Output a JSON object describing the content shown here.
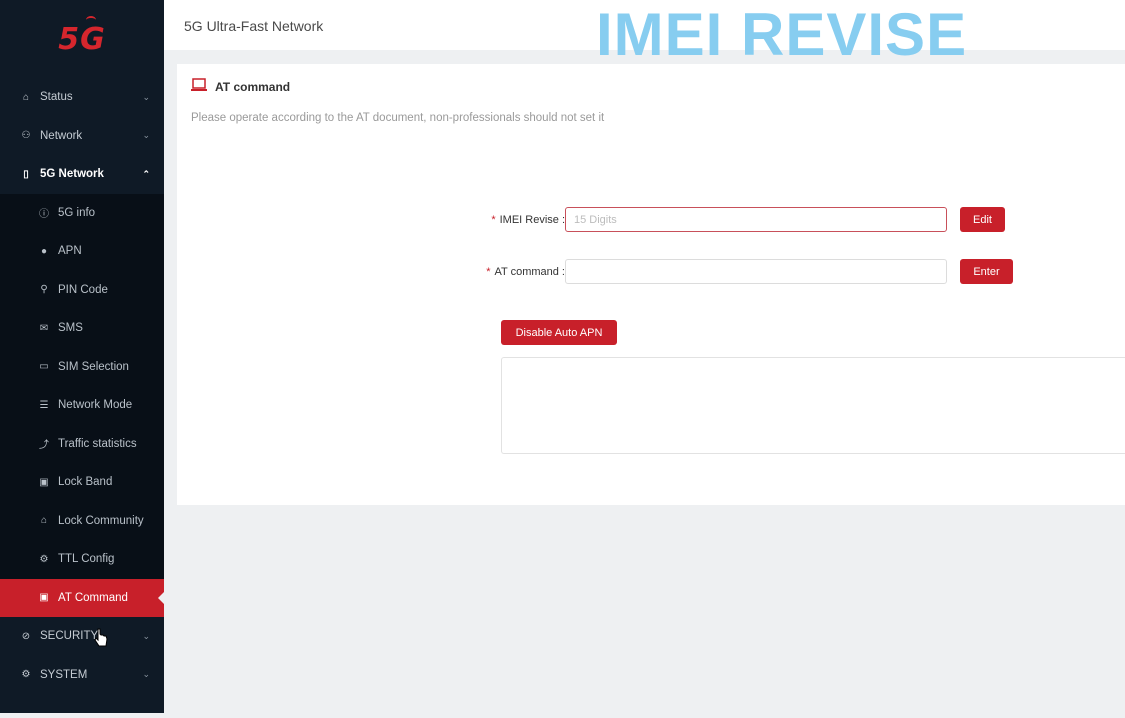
{
  "brand": {
    "logo_text": "5G"
  },
  "header": {
    "title": "5G Ultra-Fast Network"
  },
  "watermark": "IMEI REVISE",
  "sidebar": {
    "items": [
      {
        "label": "Status",
        "icon": "home-icon",
        "type": "top"
      },
      {
        "label": "Network",
        "icon": "network-icon",
        "type": "top"
      },
      {
        "label": "5G Network",
        "icon": "phone-icon",
        "type": "top",
        "open": true
      },
      {
        "label": "5G info",
        "icon": "info-icon",
        "type": "sub"
      },
      {
        "label": "APN",
        "icon": "globe-icon",
        "type": "sub"
      },
      {
        "label": "PIN Code",
        "icon": "key-icon",
        "type": "sub"
      },
      {
        "label": "SMS",
        "icon": "mail-icon",
        "type": "sub"
      },
      {
        "label": "SIM Selection",
        "icon": "card-icon",
        "type": "sub"
      },
      {
        "label": "Network Mode",
        "icon": "list-icon",
        "type": "sub"
      },
      {
        "label": "Traffic statistics",
        "icon": "trend-icon",
        "type": "sub"
      },
      {
        "label": "Lock Band",
        "icon": "grid-icon",
        "type": "sub"
      },
      {
        "label": "Lock Community",
        "icon": "home-icon",
        "type": "sub"
      },
      {
        "label": "TTL Config",
        "icon": "gear-icon",
        "type": "sub"
      },
      {
        "label": "AT Command",
        "icon": "laptop-icon",
        "type": "sub",
        "active": true
      },
      {
        "label": "SECURITY",
        "icon": "shield-icon",
        "type": "top"
      },
      {
        "label": "SYSTEM",
        "icon": "gear-icon",
        "type": "top"
      }
    ]
  },
  "card": {
    "title": "AT command",
    "description": "Please operate according to the AT document, non-professionals should not set it",
    "imei": {
      "label": "IMEI Revise :",
      "placeholder": "15 Digits",
      "value": "",
      "button": "Edit"
    },
    "at": {
      "label": "AT command :",
      "placeholder": "",
      "value": "",
      "button": "Enter"
    },
    "disable_auto_apn": "Disable Auto APN"
  },
  "colors": {
    "accent": "#c8202a",
    "sidebar_bg": "#0f1a26",
    "watermark": "#87cdf0"
  }
}
